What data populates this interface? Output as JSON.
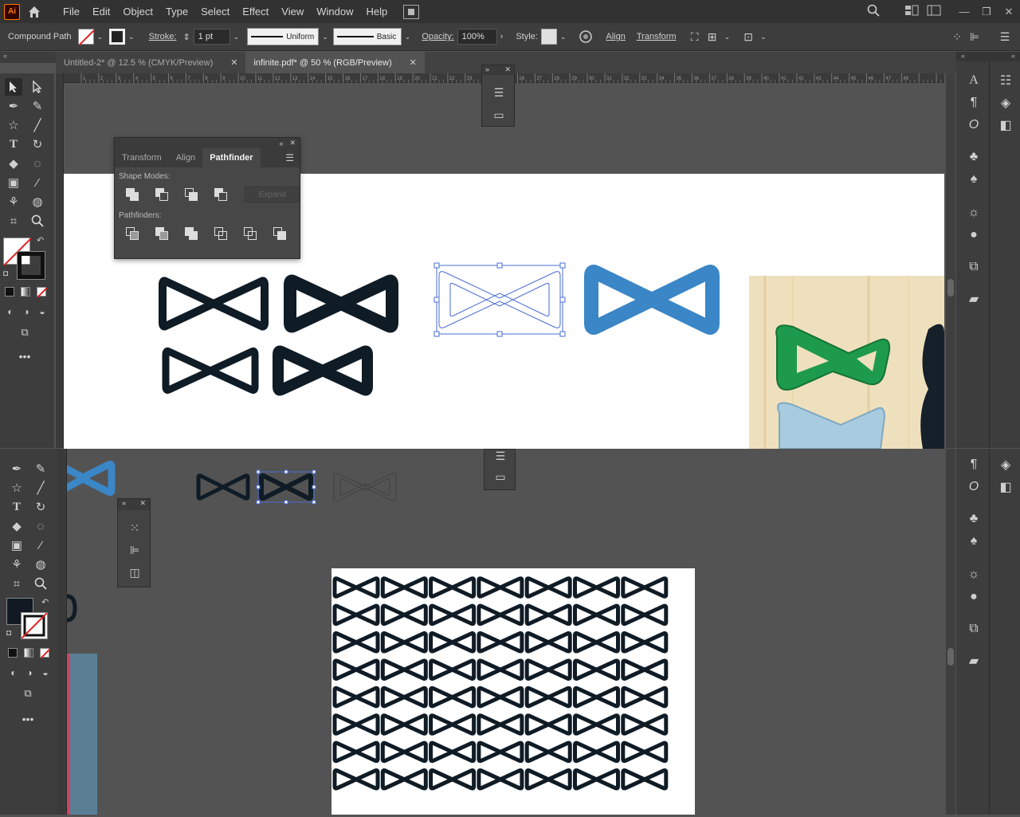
{
  "app": {
    "logo": "Ai"
  },
  "menu": [
    "File",
    "Edit",
    "Object",
    "Type",
    "Select",
    "Effect",
    "View",
    "Window",
    "Help"
  ],
  "control_bar": {
    "object_type": "Compound Path",
    "stroke_label": "Stroke:",
    "stroke_weight": "1 pt",
    "stroke_profile": "Uniform",
    "brush": "Basic",
    "opacity_label": "Opacity:",
    "opacity_value": "100%",
    "style_label": "Style:",
    "align_label": "Align",
    "transform_label": "Transform"
  },
  "tabs": [
    {
      "label": "Untitled-2* @ 12.5 % (CMYK/Preview)",
      "active": false
    },
    {
      "label": "infinite.pdf* @ 50 % (RGB/Preview)",
      "active": true
    }
  ],
  "pathfinder_panel": {
    "tabs": [
      "Transform",
      "Align",
      "Pathfinder"
    ],
    "active_tab": "Pathfinder",
    "shape_modes_label": "Shape Modes:",
    "expand_label": "Expand",
    "pathfinders_label": "Pathfinders:"
  },
  "ruler_numbers": [
    "1",
    "2",
    "3",
    "4",
    "5",
    "6",
    "7",
    "8",
    "9",
    "10",
    "11",
    "12",
    "13",
    "14",
    "15",
    "16",
    "17",
    "18",
    "19",
    "20",
    "21",
    "22",
    "23",
    "24",
    "25",
    "26",
    "27",
    "28",
    "29",
    "30",
    "31",
    "32",
    "33",
    "34",
    "35",
    "36",
    "37",
    "38",
    "39",
    "40",
    "41",
    "42",
    "43",
    "44",
    "45",
    "46",
    "47",
    "48"
  ],
  "colors": {
    "accent_blue": "#3a86c6",
    "dark_shape": "#0f1b25",
    "selection": "#4a6cd4",
    "panel_bg": "#3d3d3d",
    "canvas_bg": "#535353"
  },
  "icons": {
    "home": "home-icon",
    "search": "search-icon",
    "arrange": "arrange-documents-icon",
    "hamburger": "panel-menu-icon"
  }
}
